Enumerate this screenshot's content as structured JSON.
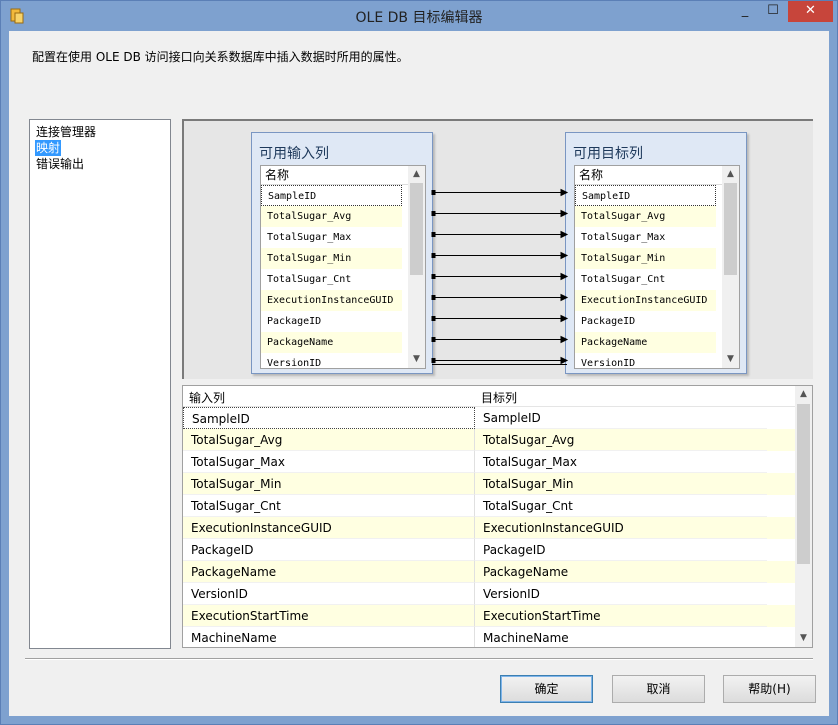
{
  "window": {
    "title": "OLE DB 目标编辑器",
    "controls": {
      "min": "_",
      "max": "☐",
      "close": "✕"
    }
  },
  "description": "配置在使用 OLE DB 访问接口向关系数据库中插入数据时所用的属性。",
  "nav": {
    "items": [
      {
        "label": "连接管理器"
      },
      {
        "label": "映射",
        "selected": true
      },
      {
        "label": "错误输出"
      }
    ]
  },
  "diagram": {
    "input_box": {
      "title": "可用输入列",
      "header": "名称",
      "rows": [
        "SampleID",
        "TotalSugar_Avg",
        "TotalSugar_Max",
        "TotalSugar_Min",
        "TotalSugar_Cnt",
        "ExecutionInstanceGUID",
        "PackageID",
        "PackageName",
        "VersionID"
      ]
    },
    "target_box": {
      "title": "可用目标列",
      "header": "名称",
      "rows": [
        "SampleID",
        "TotalSugar_Avg",
        "TotalSugar_Max",
        "TotalSugar_Min",
        "TotalSugar_Cnt",
        "ExecutionInstanceGUID",
        "PackageID",
        "PackageName",
        "VersionID"
      ]
    }
  },
  "grid": {
    "headers": {
      "input": "输入列",
      "target": "目标列"
    },
    "rows": [
      {
        "input": "SampleID",
        "target": "SampleID"
      },
      {
        "input": "TotalSugar_Avg",
        "target": "TotalSugar_Avg"
      },
      {
        "input": "TotalSugar_Max",
        "target": "TotalSugar_Max"
      },
      {
        "input": "TotalSugar_Min",
        "target": "TotalSugar_Min"
      },
      {
        "input": "TotalSugar_Cnt",
        "target": "TotalSugar_Cnt"
      },
      {
        "input": "ExecutionInstanceGUID",
        "target": "ExecutionInstanceGUID"
      },
      {
        "input": "PackageID",
        "target": "PackageID"
      },
      {
        "input": "PackageName",
        "target": "PackageName"
      },
      {
        "input": "VersionID",
        "target": "VersionID"
      },
      {
        "input": "ExecutionStartTime",
        "target": "ExecutionStartTime"
      },
      {
        "input": "MachineName",
        "target": "MachineName"
      }
    ]
  },
  "buttons": {
    "ok": "确定",
    "cancel": "取消",
    "help": "帮助(H)"
  },
  "colors": {
    "accent": "#3399ff",
    "alt_row": "#ffffe1",
    "close": "#c7453b"
  }
}
